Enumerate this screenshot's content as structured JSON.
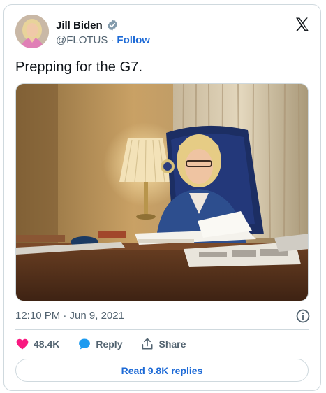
{
  "author": {
    "name": "Jill Biden",
    "handle": "@FLOTUS",
    "separator": "·",
    "follow_label": "Follow"
  },
  "icons": {
    "verified": "verified-badge-icon",
    "platform": "x-logo-icon",
    "info": "info-icon",
    "like": "heart-icon",
    "reply": "speech-bubble-icon",
    "share": "share-upload-icon"
  },
  "tweet": {
    "text": "Prepping for the G7.",
    "timestamp": "12:10 PM · Jun 9, 2021"
  },
  "actions": {
    "like_count": "48.4K",
    "reply_label": "Reply",
    "share_label": "Share"
  },
  "read_replies_label": "Read 9.8K replies",
  "colors": {
    "link_blue": "#1d6ad6",
    "like_pink": "#f91880",
    "reply_blue": "#1d9bf0",
    "muted_text": "#536471",
    "border": "#cfd9de"
  }
}
